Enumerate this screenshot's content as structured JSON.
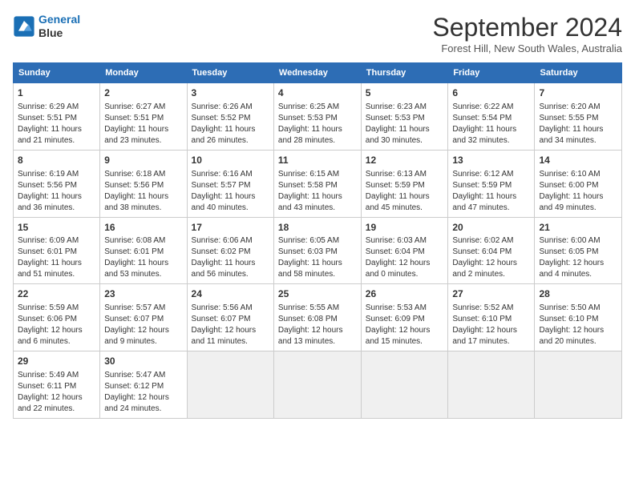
{
  "logo": {
    "line1": "General",
    "line2": "Blue"
  },
  "title": "September 2024",
  "subtitle": "Forest Hill, New South Wales, Australia",
  "headers": [
    "Sunday",
    "Monday",
    "Tuesday",
    "Wednesday",
    "Thursday",
    "Friday",
    "Saturday"
  ],
  "weeks": [
    [
      {
        "day": "1",
        "sunrise": "6:29 AM",
        "sunset": "5:51 PM",
        "daylight": "11 hours and 21 minutes."
      },
      {
        "day": "2",
        "sunrise": "6:27 AM",
        "sunset": "5:51 PM",
        "daylight": "11 hours and 23 minutes."
      },
      {
        "day": "3",
        "sunrise": "6:26 AM",
        "sunset": "5:52 PM",
        "daylight": "11 hours and 26 minutes."
      },
      {
        "day": "4",
        "sunrise": "6:25 AM",
        "sunset": "5:53 PM",
        "daylight": "11 hours and 28 minutes."
      },
      {
        "day": "5",
        "sunrise": "6:23 AM",
        "sunset": "5:53 PM",
        "daylight": "11 hours and 30 minutes."
      },
      {
        "day": "6",
        "sunrise": "6:22 AM",
        "sunset": "5:54 PM",
        "daylight": "11 hours and 32 minutes."
      },
      {
        "day": "7",
        "sunrise": "6:20 AM",
        "sunset": "5:55 PM",
        "daylight": "11 hours and 34 minutes."
      }
    ],
    [
      {
        "day": "8",
        "sunrise": "6:19 AM",
        "sunset": "5:56 PM",
        "daylight": "11 hours and 36 minutes."
      },
      {
        "day": "9",
        "sunrise": "6:18 AM",
        "sunset": "5:56 PM",
        "daylight": "11 hours and 38 minutes."
      },
      {
        "day": "10",
        "sunrise": "6:16 AM",
        "sunset": "5:57 PM",
        "daylight": "11 hours and 40 minutes."
      },
      {
        "day": "11",
        "sunrise": "6:15 AM",
        "sunset": "5:58 PM",
        "daylight": "11 hours and 43 minutes."
      },
      {
        "day": "12",
        "sunrise": "6:13 AM",
        "sunset": "5:59 PM",
        "daylight": "11 hours and 45 minutes."
      },
      {
        "day": "13",
        "sunrise": "6:12 AM",
        "sunset": "5:59 PM",
        "daylight": "11 hours and 47 minutes."
      },
      {
        "day": "14",
        "sunrise": "6:10 AM",
        "sunset": "6:00 PM",
        "daylight": "11 hours and 49 minutes."
      }
    ],
    [
      {
        "day": "15",
        "sunrise": "6:09 AM",
        "sunset": "6:01 PM",
        "daylight": "11 hours and 51 minutes."
      },
      {
        "day": "16",
        "sunrise": "6:08 AM",
        "sunset": "6:01 PM",
        "daylight": "11 hours and 53 minutes."
      },
      {
        "day": "17",
        "sunrise": "6:06 AM",
        "sunset": "6:02 PM",
        "daylight": "11 hours and 56 minutes."
      },
      {
        "day": "18",
        "sunrise": "6:05 AM",
        "sunset": "6:03 PM",
        "daylight": "11 hours and 58 minutes."
      },
      {
        "day": "19",
        "sunrise": "6:03 AM",
        "sunset": "6:04 PM",
        "daylight": "12 hours and 0 minutes."
      },
      {
        "day": "20",
        "sunrise": "6:02 AM",
        "sunset": "6:04 PM",
        "daylight": "12 hours and 2 minutes."
      },
      {
        "day": "21",
        "sunrise": "6:00 AM",
        "sunset": "6:05 PM",
        "daylight": "12 hours and 4 minutes."
      }
    ],
    [
      {
        "day": "22",
        "sunrise": "5:59 AM",
        "sunset": "6:06 PM",
        "daylight": "12 hours and 6 minutes."
      },
      {
        "day": "23",
        "sunrise": "5:57 AM",
        "sunset": "6:07 PM",
        "daylight": "12 hours and 9 minutes."
      },
      {
        "day": "24",
        "sunrise": "5:56 AM",
        "sunset": "6:07 PM",
        "daylight": "12 hours and 11 minutes."
      },
      {
        "day": "25",
        "sunrise": "5:55 AM",
        "sunset": "6:08 PM",
        "daylight": "12 hours and 13 minutes."
      },
      {
        "day": "26",
        "sunrise": "5:53 AM",
        "sunset": "6:09 PM",
        "daylight": "12 hours and 15 minutes."
      },
      {
        "day": "27",
        "sunrise": "5:52 AM",
        "sunset": "6:10 PM",
        "daylight": "12 hours and 17 minutes."
      },
      {
        "day": "28",
        "sunrise": "5:50 AM",
        "sunset": "6:10 PM",
        "daylight": "12 hours and 20 minutes."
      }
    ],
    [
      {
        "day": "29",
        "sunrise": "5:49 AM",
        "sunset": "6:11 PM",
        "daylight": "12 hours and 22 minutes."
      },
      {
        "day": "30",
        "sunrise": "5:47 AM",
        "sunset": "6:12 PM",
        "daylight": "12 hours and 24 minutes."
      },
      null,
      null,
      null,
      null,
      null
    ]
  ],
  "labels": {
    "sunrise": "Sunrise: ",
    "sunset": "Sunset: ",
    "daylight": "Daylight hours"
  }
}
